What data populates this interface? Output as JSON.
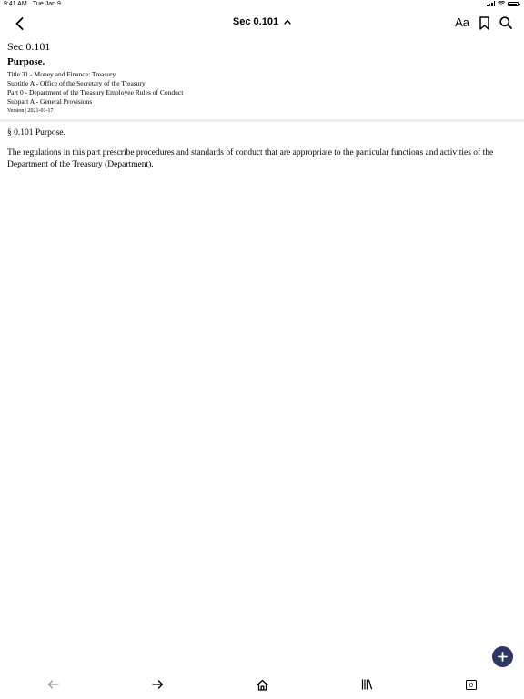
{
  "status_bar": {
    "time": "9:41 AM",
    "date": "Tue Jan 9",
    "battery_level": 1.0
  },
  "nav": {
    "title": "Sec 0.101",
    "back_icon": "chevron-left-icon",
    "title_icon": "chevron-up-icon",
    "font_size_label": "Aa",
    "bookmark_icon": "bookmark-icon",
    "search_icon": "search-icon"
  },
  "document": {
    "section_number": "Sec 0.101",
    "section_heading": "Purpose.",
    "hierarchy": [
      "Title 31 - Money and Finance: Treasury",
      "Subtitle A - Office of the Secretary of the Treasury",
      "Part 0 - Department of the Treasury Employee Rules of Conduct",
      "Subpart A - General Provisions"
    ],
    "version": "Version | 2021-01-17",
    "subtitle": "§ 0.101 Purpose.",
    "paragraph": "The regulations in this part prescribe procedures and standards of conduct that are appropriate to the particular functions and activities of the Department of the Treasury (Department)."
  },
  "fab": {
    "icon": "plus-icon",
    "color": "#2d3566"
  },
  "toolbar": {
    "back_icon": "arrow-left-icon",
    "forward_icon": "arrow-right-icon",
    "home_icon": "home-icon",
    "library_icon": "library-icon",
    "tab_count": "0"
  },
  "colors": {
    "divider": "#ececec",
    "disabled": "#9a9a9a"
  }
}
